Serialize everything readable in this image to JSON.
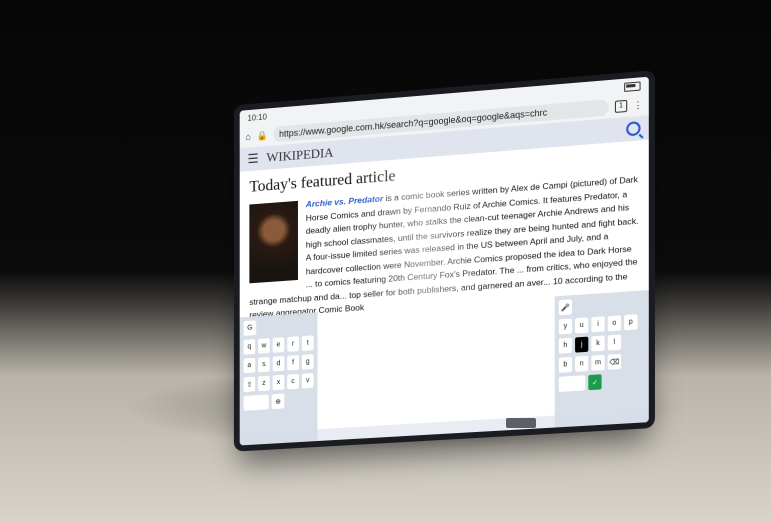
{
  "status": {
    "time": "10:10"
  },
  "browser": {
    "url": "https://www.google.com.hk/search?q=google&oq=google&aqs=chrc",
    "tab_count": "1"
  },
  "wiki": {
    "logo": "WIKIPEDIA"
  },
  "article": {
    "heading": "Today's featured article",
    "lead": "Archie vs. Predator",
    "text1": " is a comic book series written by Alex de Campi (pictured) of Dark Horse Comics and drawn by Fernando Ruiz of Archie Comics. It features Predator, a deadly alien trophy hunter, who stalks the clean-cut teenager Archie Andrews and his high school classmates, until the survivors realize they are being hunted and fight back. A four-issue limited series was released in the US between April and July, and a hardcover collection were November. Archie Comics proposed the idea to Dark Horse ... to comics featuring 20th Century Fox's Predator. The ... from critics, who enjoyed the strange matchup and da... top seller for both publishers, and garnered an aver... 10 according to the review aggregator Comic Book"
  },
  "keyboard": {
    "left_label": "G",
    "left_row1": [
      "q",
      "w",
      "e",
      "r",
      "t"
    ],
    "left_row2": [
      "a",
      "s",
      "d",
      "f",
      "g"
    ],
    "left_row3": [
      "z",
      "x",
      "c",
      "v"
    ],
    "right_row1": [
      "y",
      "u",
      "i",
      "o",
      "p"
    ],
    "right_row2": [
      "h",
      "j",
      "k",
      "l"
    ],
    "right_row3": [
      "b",
      "n",
      "m"
    ]
  }
}
